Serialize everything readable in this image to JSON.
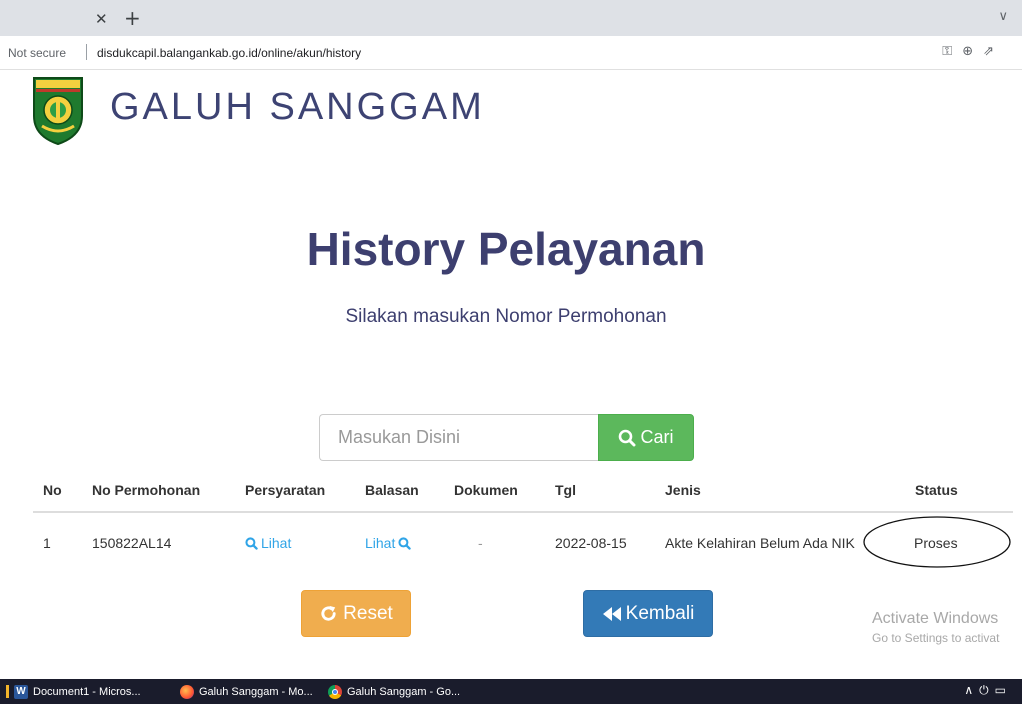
{
  "browser": {
    "tab_close_icon": "close-icon",
    "new_tab_icon": "plus-icon",
    "tab_menu_icon": "chevron-down-icon",
    "security_label": "Not secure",
    "url": "disdukcapil.balangankab.go.id/online/akun/history",
    "address_icons": [
      "key-icon",
      "zoom-icon",
      "share-icon"
    ]
  },
  "site": {
    "title": "GALUH SANGGAM",
    "logo_icon": "balangan-regency-emblem"
  },
  "page": {
    "heading": "History Pelayanan",
    "subheading": "Silakan masukan Nomor Permohonan"
  },
  "search": {
    "placeholder": "Masukan Disini",
    "value": "",
    "button_label": "Cari",
    "button_icon": "search-icon"
  },
  "table": {
    "columns": [
      "No",
      "No Permohonan",
      "Persyaratan",
      "Balasan",
      "Dokumen",
      "Tgl",
      "Jenis",
      "Status"
    ],
    "rows": [
      {
        "no": "1",
        "no_permohonan": "150822AL14",
        "persyaratan": "Lihat",
        "balasan": "Lihat",
        "dokumen": "-",
        "tgl": "2022-08-15",
        "jenis": "Akte Kelahiran Belum Ada NIK",
        "status": "Proses"
      }
    ]
  },
  "actions": {
    "reset_label": "Reset",
    "reset_icon": "refresh-icon",
    "back_label": "Kembali",
    "back_icon": "fast-backward-icon"
  },
  "watermark": {
    "title": "Activate Windows",
    "subtitle": "Go to Settings to activat"
  },
  "taskbar": {
    "items": [
      {
        "label": "Document1 - Micros...",
        "icon": "word-icon"
      },
      {
        "label": "Galuh Sanggam - Mo...",
        "icon": "firefox-icon"
      },
      {
        "label": "Galuh Sanggam - Go...",
        "icon": "chrome-icon"
      }
    ]
  },
  "colors": {
    "heading": "#3d3f6f",
    "link": "#2fa4e7",
    "search_button": "#5cb85c",
    "reset_button": "#f0ad4e",
    "back_button": "#337ab7"
  }
}
